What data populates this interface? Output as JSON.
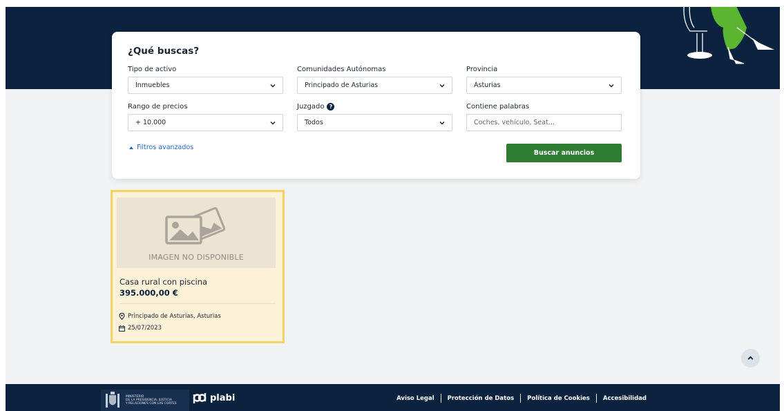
{
  "search": {
    "title": "¿Qué buscas?",
    "fields": {
      "tipo": {
        "label": "Tipo de activo",
        "value": "Inmuebles"
      },
      "comunidad": {
        "label": "Comunidades Autónomas",
        "value": "Principado de Asturias"
      },
      "provincia": {
        "label": "Provincia",
        "value": "Asturias"
      },
      "precio": {
        "label": "Rango de precios",
        "value": "+ 10.000"
      },
      "juzgado": {
        "label": "Juzgado",
        "value": "Todos"
      },
      "palabras": {
        "label": "Contiene palabras",
        "placeholder": "Coches, vehículo, Seat..."
      }
    },
    "advanced_label": "Filtros avanzados",
    "submit_label": "Buscar anuncios"
  },
  "results": [
    {
      "image_placeholder": "IMAGEN NO DISPONIBLE",
      "title": "Casa rural con piscina",
      "price": "395.000,00 €",
      "location": "Principado de Asturias, Asturias",
      "date": "25/07/2023"
    }
  ],
  "footer": {
    "gov_lines": [
      "MINISTERIO",
      "DE LA PRESIDENCIA, JUSTICIA",
      "Y RELACIONES CON LAS CORTES"
    ],
    "brand": "plabi",
    "links": [
      "Aviso Legal",
      "Protección de Datos",
      "Política de Cookies",
      "Accesibilidad"
    ]
  },
  "colors": {
    "navy": "#0c2340",
    "accent_green": "#2e7d32",
    "link_blue": "#1f66c9",
    "highlight": "#f5d264",
    "card_bg": "#fdf1d7"
  }
}
